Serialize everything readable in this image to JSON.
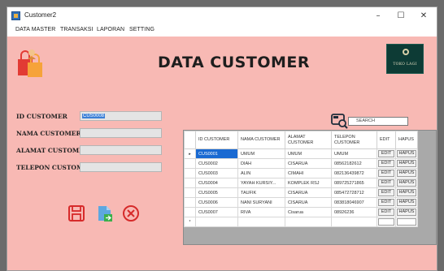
{
  "window": {
    "title": "Customer2",
    "minimize": "–",
    "maximize": "☐",
    "close": "✕"
  },
  "menu": [
    "DATA MASTER",
    "TRANSAKSI",
    "LAPORAN",
    "SETTING"
  ],
  "page_title": "DATA CUSTOMER",
  "logo_text": "TOKO LAGI",
  "form": {
    "id_label": "ID CUSTOMER",
    "id_value": "CUS0008",
    "nama_label": "NAMA CUSTOMER",
    "alamat_label": "ALAMAT CUSTOMER",
    "telepon_label": "TELEPON CUSTOMER"
  },
  "search": {
    "placeholder": "SEARCH"
  },
  "grid": {
    "columns": [
      "ID CUSTOMER",
      "NAMA CUSTOMER",
      "ALAMAT CUSTOMER",
      "TELEPON CUSTOMER",
      "EDIT",
      "HAPUS"
    ],
    "current_row_marker": "▸",
    "new_row_marker": "*",
    "rows": [
      [
        "CUS0001",
        "UMUM",
        "UMUM",
        "UMUM",
        "EDIT",
        "HAPUS"
      ],
      [
        "CUS0002",
        "DIAH",
        "CISARUA",
        "08562182612",
        "EDIT",
        "HAPUS"
      ],
      [
        "CUS0003",
        "ALIN",
        "CIMAHI",
        "082136439872",
        "EDIT",
        "HAPUS"
      ],
      [
        "CUS0004",
        "YAYAH KURSIY...",
        "KOMPLEK RSJ",
        "089725271865",
        "EDIT",
        "HAPUS"
      ],
      [
        "CUS0005",
        "TAUFIK",
        "CISARUA",
        "085472728712",
        "EDIT",
        "HAPUS"
      ],
      [
        "CUS0006",
        "NANI SURYANI",
        "CISARUA",
        "083818046907",
        "EDIT",
        "HAPUS"
      ],
      [
        "CUS0007",
        "RIVA",
        "Cisarua",
        "08926236",
        "EDIT",
        "HAPUS"
      ]
    ]
  },
  "icons": {
    "save": "save-icon",
    "export": "export-icon",
    "cancel": "cancel-icon",
    "search": "search-icon",
    "shop": "shopping-bag-icon"
  },
  "colors": {
    "background": "#f8b9b4",
    "selection": "#1a6ad2",
    "cancel_red": "#d62a2a",
    "logo_bg": "#0d3b35"
  }
}
